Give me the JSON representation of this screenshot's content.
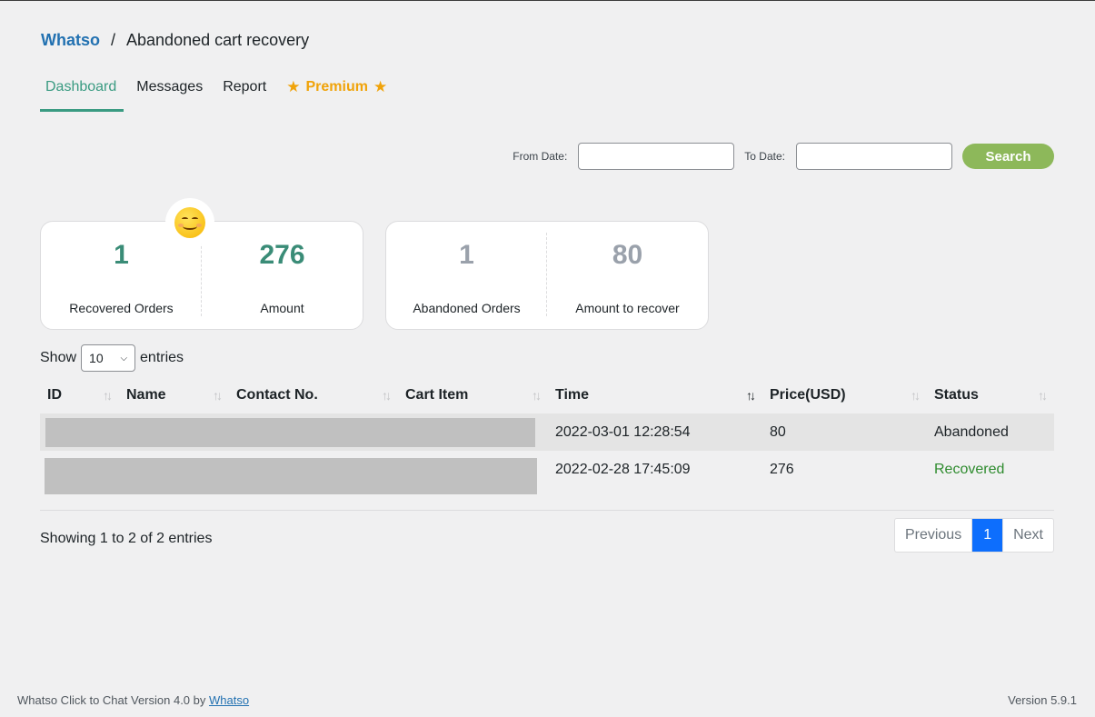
{
  "breadcrumb": {
    "brand": "Whatso",
    "separator": "/",
    "title": "Abandoned cart recovery"
  },
  "tabs": [
    {
      "label": "Dashboard",
      "active": true
    },
    {
      "label": "Messages"
    },
    {
      "label": "Report"
    },
    {
      "label": "Premium",
      "icon": "star-icon"
    }
  ],
  "filter": {
    "from_label": "From Date:",
    "from_value": "",
    "to_label": "To Date:",
    "to_value": "",
    "search_label": "Search"
  },
  "cards": {
    "recovered": {
      "orders": "1",
      "orders_label": "Recovered Orders",
      "amount": "276",
      "amount_label": "Amount",
      "icon": "smiley-icon"
    },
    "abandoned": {
      "orders": "1",
      "orders_label": "Abandoned Orders",
      "amount": "80",
      "amount_label": "Amount to recover"
    }
  },
  "entries": {
    "show": "Show",
    "value": "10",
    "suffix": "entries"
  },
  "table": {
    "headers": [
      "ID",
      "Name",
      "Contact No.",
      "Cart Item",
      "Time",
      "Price(USD)",
      "Status"
    ],
    "rows": [
      {
        "time": "2022-03-01 12:28:54",
        "price": "80",
        "status": "Abandoned"
      },
      {
        "time": "2022-02-28 17:45:09",
        "price": "276",
        "status": "Recovered"
      }
    ]
  },
  "pagination": {
    "info": "Showing 1 to 2 of 2 entries",
    "previous": "Previous",
    "current": "1",
    "next": "Next"
  },
  "footer": {
    "left_text": "Whatso Click to Chat Version 4.0 by ",
    "left_link": "Whatso",
    "version": "Version 5.9.1"
  },
  "colors": {
    "accent": "#3a9b82",
    "premium": "#f0a30a",
    "search": "#8db85a",
    "page_current": "#0d6efd"
  }
}
